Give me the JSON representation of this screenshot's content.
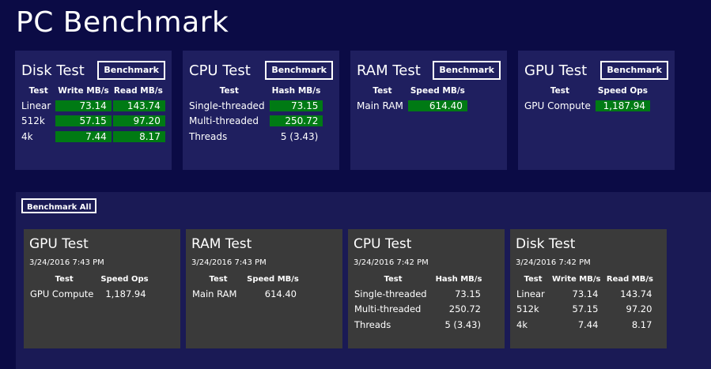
{
  "app": {
    "title": "PC Benchmark"
  },
  "tiles": {
    "disk": {
      "title": "Disk Test",
      "button": "Benchmark",
      "headers": [
        "Test",
        "Write MB/s",
        "Read MB/s"
      ],
      "rows": [
        [
          "Linear",
          "73.14",
          "143.74"
        ],
        [
          "512k",
          "57.15",
          "97.20"
        ],
        [
          "4k",
          "7.44",
          "8.17"
        ]
      ]
    },
    "cpu": {
      "title": "CPU Test",
      "button": "Benchmark",
      "headers": [
        "Test",
        "Hash MB/s"
      ],
      "rows": [
        [
          "Single-threaded",
          "73.15"
        ],
        [
          "Multi-threaded",
          "250.72"
        ],
        [
          "Threads",
          "5 (3.43)"
        ]
      ]
    },
    "ram": {
      "title": "RAM Test",
      "button": "Benchmark",
      "headers": [
        "Test",
        "Speed MB/s"
      ],
      "rows": [
        [
          "Main RAM",
          "614.40"
        ]
      ]
    },
    "gpu": {
      "title": "GPU Test",
      "button": "Benchmark",
      "headers": [
        "Test",
        "Speed Ops"
      ],
      "rows": [
        [
          "GPU Compute",
          "1,187.94"
        ]
      ]
    }
  },
  "history": {
    "button": "Benchmark All",
    "gpu": {
      "title": "GPU Test",
      "date": "3/24/2016 7:43 PM",
      "headers": [
        "Test",
        "Speed Ops"
      ],
      "rows": [
        [
          "GPU Compute",
          "1,187.94"
        ]
      ]
    },
    "ram": {
      "title": "RAM Test",
      "date": "3/24/2016 7:43 PM",
      "headers": [
        "Test",
        "Speed MB/s"
      ],
      "rows": [
        [
          "Main RAM",
          "614.40"
        ]
      ]
    },
    "cpu": {
      "title": "CPU Test",
      "date": "3/24/2016 7:42 PM",
      "headers": [
        "Test",
        "Hash MB/s"
      ],
      "rows": [
        [
          "Single-threaded",
          "73.15"
        ],
        [
          "Multi-threaded",
          "250.72"
        ],
        [
          "Threads",
          "5 (3.43)"
        ]
      ]
    },
    "disk": {
      "title": "Disk Test",
      "date": "3/24/2016 7:42 PM",
      "headers": [
        "Test",
        "Write MB/s",
        "Read MB/s"
      ],
      "rows": [
        [
          "Linear",
          "73.14",
          "143.74"
        ],
        [
          "512k",
          "57.15",
          "97.20"
        ],
        [
          "4k",
          "7.44",
          "8.17"
        ]
      ]
    }
  },
  "colors": {
    "background": "#0b0b45",
    "tile": "#1f1f5f",
    "history_panel": "#1a1a55",
    "history_card": "#3a3a3a",
    "result_highlight": "#007a14"
  }
}
